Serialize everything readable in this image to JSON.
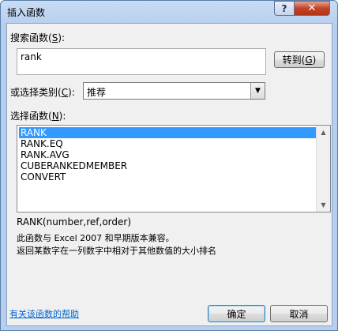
{
  "window": {
    "title": "插入函数",
    "help_glyph": "?",
    "close_glyph": "✕"
  },
  "search": {
    "label_prefix": "搜索函数(",
    "label_key": "S",
    "label_suffix": "):",
    "value": "rank",
    "go_prefix": "转到(",
    "go_key": "G",
    "go_suffix": ")"
  },
  "category": {
    "label_prefix": "或选择类别(",
    "label_key": "C",
    "label_suffix": "):",
    "selected": "推荐",
    "arrow": "▼"
  },
  "functions": {
    "label_prefix": "选择函数(",
    "label_key": "N",
    "label_suffix": "):",
    "items": [
      "RANK",
      "RANK.EQ",
      "RANK.AVG",
      "CUBERANKEDMEMBER",
      "CONVERT"
    ],
    "selected_index": 0
  },
  "details": {
    "signature": "RANK(number,ref,order)",
    "compat": "此函数与 Excel 2007 和早期版本兼容。",
    "description": "返回某数字在一列数字中相对于其他数值的大小排名"
  },
  "footer": {
    "help_link": "有关该函数的帮助",
    "ok": "确定",
    "cancel": "取消"
  }
}
